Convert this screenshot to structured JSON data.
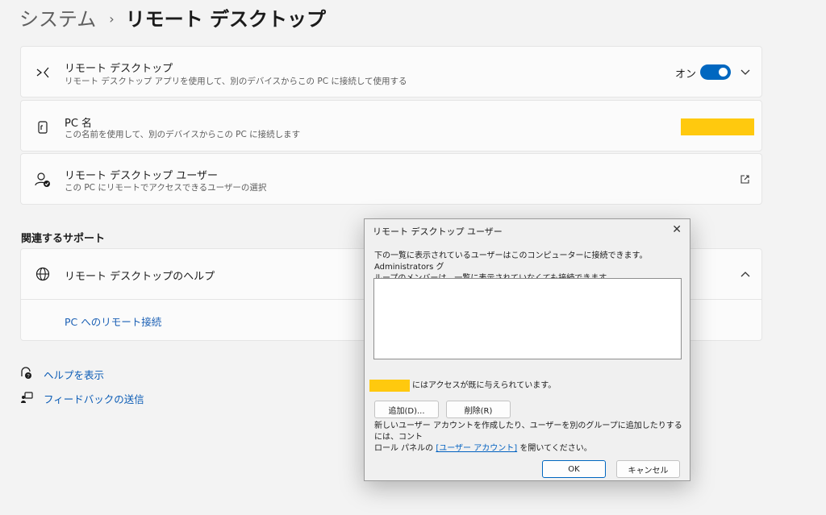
{
  "breadcrumb": {
    "parent": "システム",
    "separator": "›",
    "current": "リモート デスクトップ"
  },
  "settings": {
    "remote_desktop": {
      "title": "リモート デスクトップ",
      "subtitle": "リモート デスクトップ アプリを使用して、別のデバイスからこの PC に接続して使用する",
      "toggle_label": "オン",
      "toggle_state": true,
      "icon": "remote-desktop-icon"
    },
    "pc_name": {
      "title": "PC 名",
      "subtitle": "この名前を使用して、別のデバイスからこの PC に接続します",
      "icon": "pc-name-icon"
    },
    "users": {
      "title": "リモート デスクトップ ユーザー",
      "subtitle": "この PC にリモートでアクセスできるユーザーの選択",
      "icon": "users-icon"
    }
  },
  "support": {
    "section_title": "関連するサポート",
    "help_title": "リモート デスクトップのヘルプ",
    "link": "PC へのリモート接続"
  },
  "footer_links": {
    "help": "ヘルプを表示",
    "feedback": "フィードバックの送信"
  },
  "dialog": {
    "title": "リモート デスクトップ ユーザー",
    "close": "✕",
    "description_line1": "下の一覧に表示されているユーザーはこのコンピューターに接続できます。Administrators グ",
    "description_line2": "ループのメンバーは、一覧に表示されていなくても接続できます。",
    "access_text": "にはアクセスが既に与えられています。",
    "add_button": "追加(D)...",
    "remove_button": "削除(R)",
    "info_line1": "新しいユーザー アカウントを作成したり、ユーザーを別のグループに追加したりするには、コント",
    "info_line2_prefix": "ロール パネルの ",
    "info_link": "[ユーザー アカウント]",
    "info_line2_suffix": " を開いてください。",
    "ok_button": "OK",
    "cancel_button": "キャンセル"
  },
  "colors": {
    "accent": "#0067c0",
    "redaction": "#ffc90e",
    "link": "#0a5bb5"
  }
}
